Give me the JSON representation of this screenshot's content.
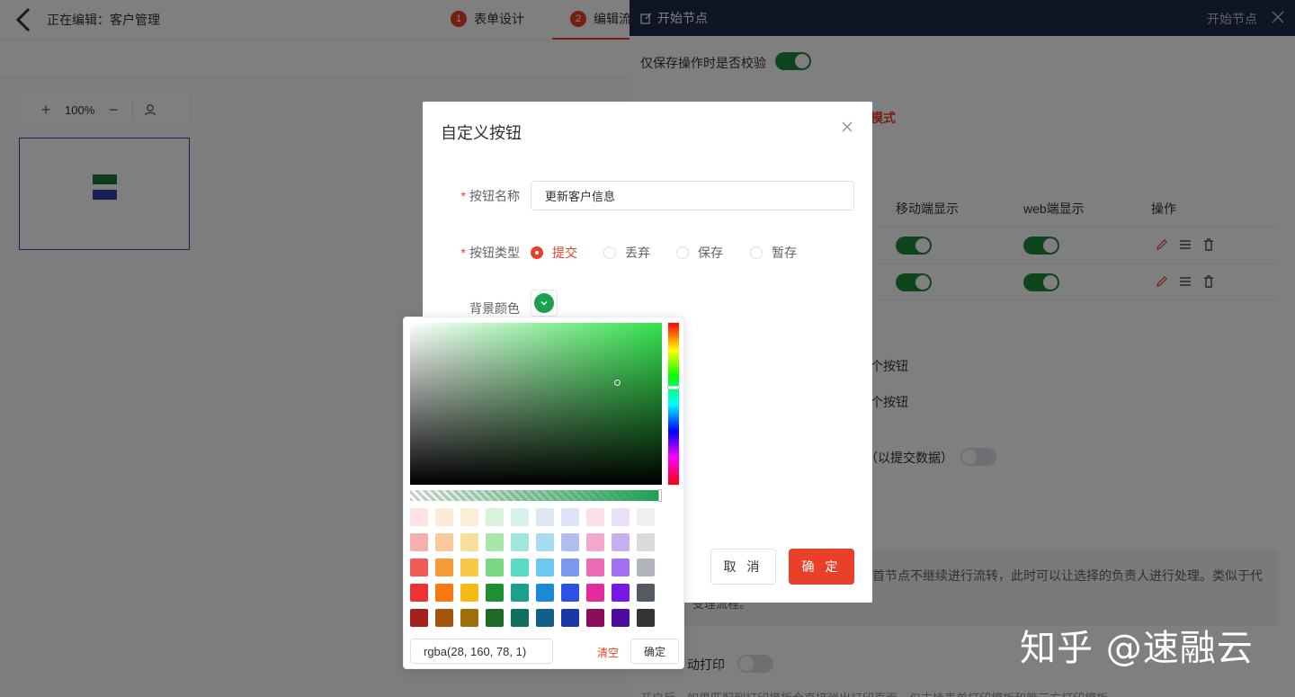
{
  "topbar": {
    "editing_label": "正在编辑：客户管理",
    "steps": [
      {
        "num": "1",
        "label": "表单设计"
      },
      {
        "num": "2",
        "label": "编辑流"
      }
    ]
  },
  "canvas": {
    "zoom_value": "100%"
  },
  "drawer": {
    "title": "开始节点",
    "subtitle": "开始节点",
    "validate_on_save_label": "仅保存操作时是否校验",
    "mode_fragment": "模式",
    "table_headers": {
      "mobile": "移动端显示",
      "web": "web端显示",
      "ops": "操作"
    },
    "fragment_button_1": "个按钮",
    "fragment_button_2": "个按钮",
    "fragment_submit": "（以提交数据）",
    "info_text": "首节点不继续进行流转，此时可以让选择的负责人进行处理。类似于代",
    "fragment_info_2": "受理流程。",
    "auto_print": "动打印",
    "bottom_note": "开启后，如果匹配到打印模板会直接弹出打印页面，仅支持表单打印模板和第三方打印模板"
  },
  "dialog": {
    "title": "自定义按钮",
    "name_label": "按钮名称",
    "name_value": "更新客户信息",
    "type_label": "按钮类型",
    "type_options": [
      "提交",
      "丢弃",
      "保存",
      "暂存"
    ],
    "type_selected": "提交",
    "bg_label": "背景颜色",
    "cancel_label": "取 消",
    "ok_label": "确 定"
  },
  "color_picker": {
    "value": "rgba(28, 160, 78, 1)",
    "clear_label": "清空",
    "confirm_label": "确定",
    "hue_color": "#32e34c",
    "swatches": [
      [
        "#fde2e2",
        "#fdebd8",
        "#fbeed6",
        "#d9f2dc",
        "#d6f2ee",
        "#dde8f3",
        "#e0e2f8",
        "#fbe0ec",
        "#ebe0f8",
        "#f0f0f1"
      ],
      [
        "#f4b0ac",
        "#f9c99a",
        "#f5df9b",
        "#a8e6ac",
        "#a1e6dc",
        "#a6dcef",
        "#b1bcef",
        "#f2a7cd",
        "#c6b1ef",
        "#d9dadd"
      ],
      [
        "#ef5a53",
        "#f69b35",
        "#f7c944",
        "#79d884",
        "#58ddc4",
        "#6cc7f2",
        "#7b97ef",
        "#ec6bb5",
        "#a46ff1",
        "#b2b6bb"
      ],
      [
        "#ec3232",
        "#f77712",
        "#f7b915",
        "#1e8f34",
        "#1ca08d",
        "#1b8ad6",
        "#2b51e8",
        "#e52b9b",
        "#7a17e5",
        "#545a63"
      ],
      [
        "#a51f1f",
        "#a3540c",
        "#9f6d0a",
        "#1d6a26",
        "#136e5e",
        "#125f8d",
        "#1a38a6",
        "#8c0c5c",
        "#4f0ba0",
        "#323437"
      ]
    ]
  },
  "watermark": "知乎 @速融云"
}
